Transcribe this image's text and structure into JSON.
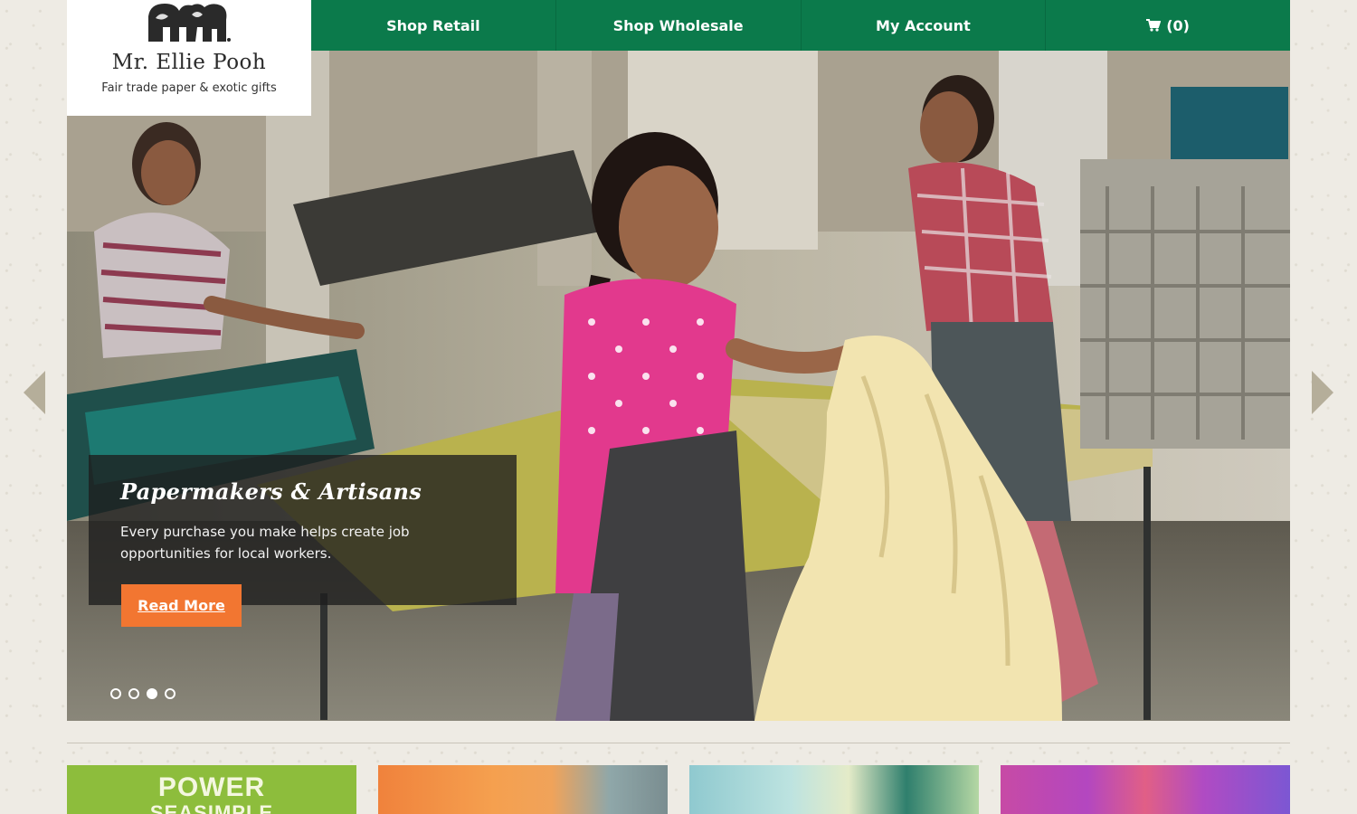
{
  "brand": {
    "name": "Mr. Ellie Pooh",
    "tagline": "Fair trade paper & exotic gifts"
  },
  "nav": {
    "items": [
      {
        "label": "Shop Retail"
      },
      {
        "label": "Shop Wholesale"
      },
      {
        "label": "My Account"
      }
    ],
    "cart": {
      "icon": "cart-icon",
      "count_label": "(0)"
    }
  },
  "hero": {
    "title": "Papermakers & Artisans",
    "text": "Every purchase you make helps create job opportunities for local workers.",
    "button_label": "Read More",
    "slide_count": 4,
    "active_slide": 3
  },
  "tiles": {
    "first_tile_text": [
      "POWER",
      "SEASIMPLE"
    ]
  },
  "colors": {
    "nav_green": "#0b7a4b",
    "button_orange": "#f27631",
    "background": "#eeebe4"
  }
}
